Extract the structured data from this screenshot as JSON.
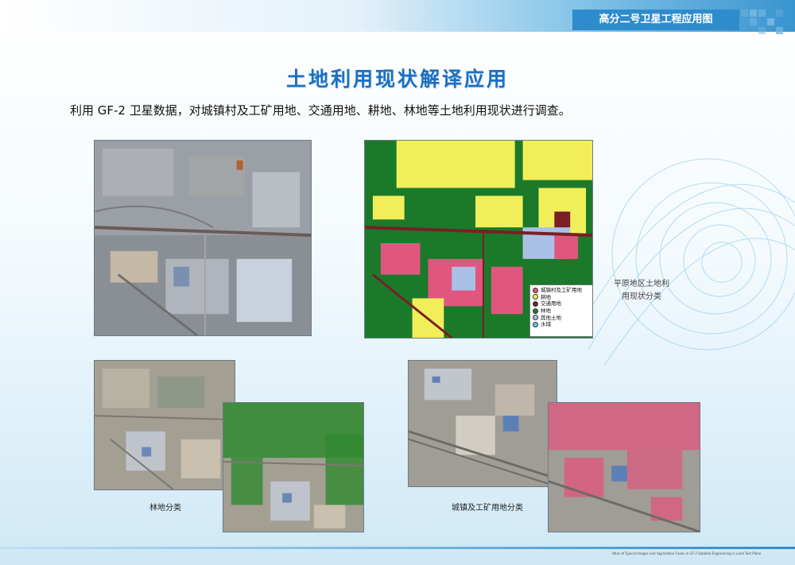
{
  "header": {
    "title": "高分二号卫星工程应用图"
  },
  "page_title": "土地利用现状解译应用",
  "intro": "利用 GF-2 卫星数据，对城镇村及工矿用地、交通用地、耕地、林地等土地利用现状进行调查。",
  "legend": {
    "items": [
      {
        "label": "城镇村及工矿用地",
        "color": "#e0567e"
      },
      {
        "label": "耕地",
        "color": "#f2ee5a"
      },
      {
        "label": "交通用地",
        "color": "#7a1f25"
      },
      {
        "label": "林地",
        "color": "#1a7a2a"
      },
      {
        "label": "其他土地",
        "color": "#a9c1e6"
      },
      {
        "label": "水域",
        "color": "#5fc6e6"
      }
    ]
  },
  "captions": {
    "side": "平原地区土地利用现状分类",
    "forest": "林地分类",
    "urban": "城镇及工矿用地分类"
  },
  "footer": {
    "text": "Atlas of Typical Images and Application Cases in GF-2 Satellite Engineering in Land Test Plane"
  }
}
